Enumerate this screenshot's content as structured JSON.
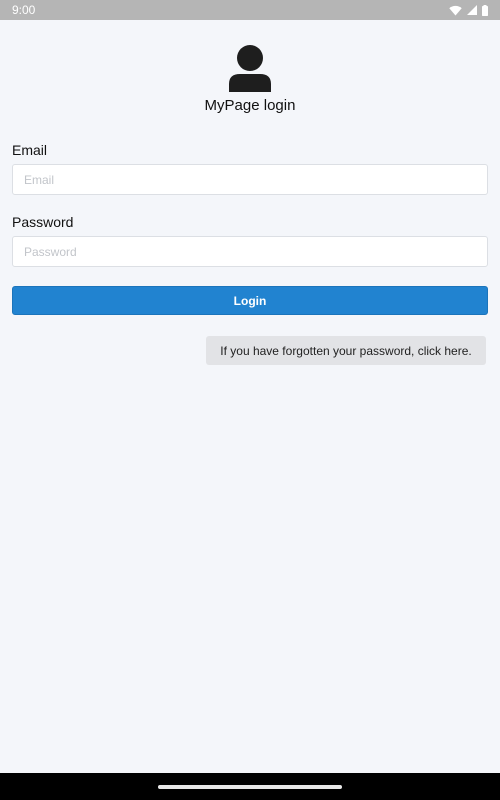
{
  "status_bar": {
    "time": "9:00",
    "icons": [
      "wifi-icon",
      "signal-icon",
      "battery-icon"
    ]
  },
  "header": {
    "avatar_icon": "user-icon",
    "title": "MyPage login"
  },
  "form": {
    "email_label": "Email",
    "email_placeholder": "Email",
    "email_value": "",
    "password_label": "Password",
    "password_placeholder": "Password",
    "password_value": "",
    "login_label": "Login",
    "forgot_label": "If you have forgotten your password, click here."
  },
  "colors": {
    "primary": "#2183d0",
    "background": "#f4f6fa",
    "secondary_button": "#e2e3e6",
    "status_bar": "#b5b5b5"
  }
}
